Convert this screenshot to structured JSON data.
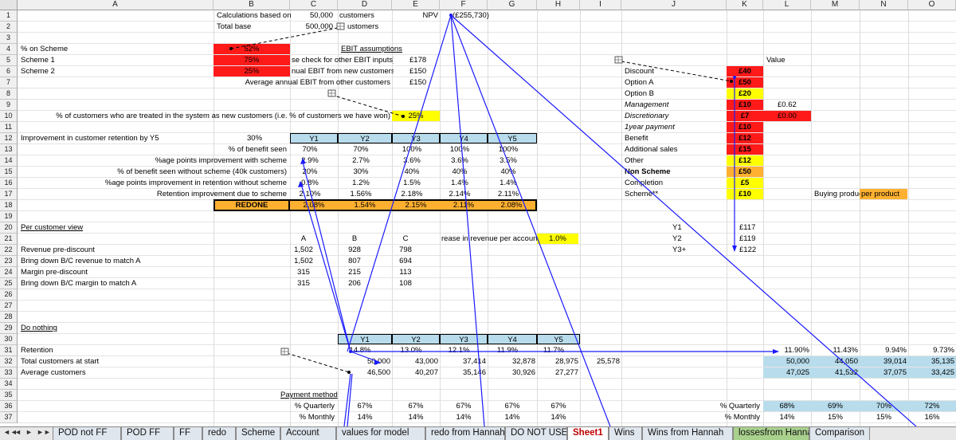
{
  "columns": [
    "A",
    "B",
    "C",
    "D",
    "E",
    "F",
    "G",
    "H",
    "I",
    "J",
    "K",
    "L",
    "M",
    "N",
    "O"
  ],
  "rows": [
    "1",
    "2",
    "3",
    "4",
    "5",
    "6",
    "7",
    "8",
    "9",
    "10",
    "11",
    "12",
    "13",
    "14",
    "15",
    "16",
    "17",
    "18",
    "19",
    "20",
    "21",
    "22",
    "23",
    "24",
    "25",
    "26",
    "27",
    "28",
    "29",
    "30",
    "31",
    "32",
    "33",
    "34",
    "35",
    "36",
    "37"
  ],
  "cells": {
    "calc_label": "Calculations based on",
    "calc_val": "50,000",
    "calc_unit": "customers",
    "npv_label": "NPV",
    "npv_val": "(£255,730)",
    "total_base": "Total base",
    "total_val": "500,000",
    "total_unit": "ustomers",
    "on_scheme": "% on Scheme",
    "on_scheme_val": "52%",
    "ebit_title": "EBIT assumptions",
    "scheme1": "Scheme 1",
    "scheme1_val": "75%",
    "scheme1_note": "se check for other EBIT inputs)",
    "scheme1_amt": "£178",
    "scheme2": "Scheme 2",
    "scheme2_val": "25%",
    "scheme2_note": "nual EBIT from new customers",
    "scheme2_amt": "£150",
    "avg_ebit": "Average annual EBIT from other customers",
    "avg_ebit_amt": "£150",
    "pct_new": "% of customers who are treated in the system as new customers (i.e. % of customers we have won)",
    "pct_new_val": "25%",
    "value_hdr": "Value",
    "k_labels": [
      "Discount",
      "Option A",
      "Option B",
      "Management",
      "Discretionary",
      "1year payment",
      "Benefit",
      "Additional sales",
      "Other",
      "Non Scheme",
      "Completion",
      "Scheme**"
    ],
    "k_vals": [
      "£40",
      "£50",
      "£20",
      "£10",
      "£7",
      "£10",
      "£12",
      "£15",
      "£12",
      "£50",
      "£5",
      "£10"
    ],
    "l9": "£0.62",
    "l10": "£0.00",
    "improve": "Improvement in customer retention by Y5",
    "improve_val": "30%",
    "y_hdrs": [
      "Y1",
      "Y2",
      "Y3",
      "Y4",
      "Y5"
    ],
    "r13_label": "% of benefit seen",
    "r13": [
      "70%",
      "70%",
      "100%",
      "100%",
      "100%"
    ],
    "r14_label": "%age points improvement with scheme",
    "r14": [
      "2.9%",
      "2.7%",
      "3.6%",
      "3.6%",
      "3.5%"
    ],
    "r15_label": "% of benefit seen without scheme (40k customers)",
    "r15": [
      "20%",
      "30%",
      "40%",
      "40%",
      "40%"
    ],
    "r16_label": "%age points improvement in retention without scheme",
    "r16": [
      "0.8%",
      "1.2%",
      "1.5%",
      "1.4%",
      "1.4%"
    ],
    "r17_label": "Retention improvement due to scheme",
    "r17": [
      "2.10%",
      "1.56%",
      "2.18%",
      "2.14%",
      "2.11%"
    ],
    "buying": "Buying produc",
    "per_product": "per product",
    "redone": "REDONE",
    "r18": [
      "2.08%",
      "1.54%",
      "2.15%",
      "2.11%",
      "2.08%"
    ],
    "per_cust": "Per customer view",
    "j20": "Y1",
    "k20": "£117",
    "j21": "Y2",
    "k21": "£119",
    "j22": "Y3+",
    "k22": "£122",
    "abc": [
      "A",
      "B",
      "C"
    ],
    "rev_inc": "rease in revenue per account",
    "rev_inc_val": "1.0%",
    "r22_label": "Revenue pre-discount",
    "r22": [
      "1,502",
      "928",
      "798"
    ],
    "r23_label": "Bring down B/C revenue to match A",
    "r23": [
      "1,502",
      "807",
      "694"
    ],
    "r24_label": "Margin pre-discount",
    "r24": [
      "315",
      "215",
      "113"
    ],
    "r25_label": "Bring down B/C margin to match A",
    "r25": [
      "315",
      "206",
      "108"
    ],
    "do_nothing": "Do nothing",
    "r31_label": "Retention",
    "r31": [
      "14.8%",
      "13.0%",
      "12.1%",
      "11.9%",
      "11.7%"
    ],
    "r31_lo": [
      "11.90%",
      "11.43%",
      "9.94%",
      "9.73%"
    ],
    "r32_label": "Total customers at start",
    "r32": [
      "50,000",
      "43,000",
      "37,414",
      "32,878",
      "28,975",
      "25,578"
    ],
    "r32_lo": [
      "50,000",
      "44,050",
      "39,014",
      "35,135"
    ],
    "r33_label": "Average customers",
    "r33": [
      "46,500",
      "40,207",
      "35,146",
      "30,926",
      "27,277"
    ],
    "r33_lo": [
      "47,025",
      "41,532",
      "37,075",
      "33,425"
    ],
    "pay_method": "Payment method",
    "r36_label": "% Quarterly",
    "r36": [
      "67%",
      "67%",
      "67%",
      "67%",
      "67%"
    ],
    "k36": "% Quarterly",
    "r36_lo": [
      "68%",
      "69%",
      "70%",
      "72%"
    ],
    "r37_label": "% Monthly",
    "r37": [
      "14%",
      "14%",
      "14%",
      "14%",
      "14%"
    ],
    "k37": "% Monthly",
    "r37_lo": [
      "14%",
      "15%",
      "15%",
      "16%"
    ]
  },
  "tabs": [
    "POD not FF",
    "POD FF",
    "FF",
    "redo",
    "Scheme",
    "Account",
    "values for model",
    "redo from Hannah",
    "DO NOT USE",
    "Sheet1",
    "Wins",
    "Wins from Hannah",
    "lossesfrom Hannah",
    "Comparison"
  ],
  "nav_glyphs": [
    "◄◄",
    "◄",
    "►",
    "►►"
  ]
}
